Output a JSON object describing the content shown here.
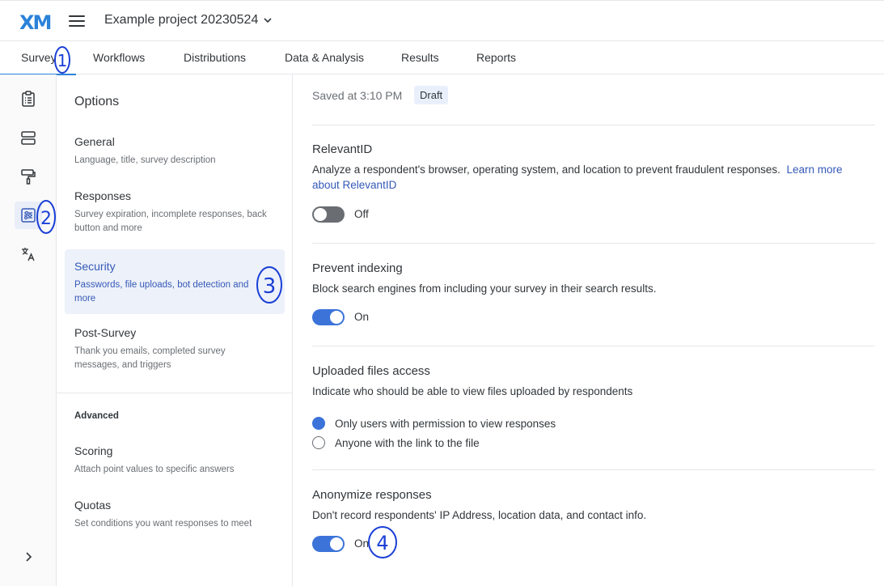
{
  "app": {
    "logo": "XM",
    "project_name": "Example project 20230524"
  },
  "tabs": [
    {
      "label": "Survey"
    },
    {
      "label": "Workflows"
    },
    {
      "label": "Distributions"
    },
    {
      "label": "Data & Analysis"
    },
    {
      "label": "Results"
    },
    {
      "label": "Reports"
    }
  ],
  "rail": {
    "icons": [
      "survey-clipboard-icon",
      "blocks-icon",
      "paint-roller-icon",
      "options-sliders-icon",
      "translate-icon"
    ],
    "expand_icon": "chevron-right-icon"
  },
  "options": {
    "title": "Options",
    "items": [
      {
        "title": "General",
        "desc": "Language, title, survey description"
      },
      {
        "title": "Responses",
        "desc": "Survey expiration, incomplete responses, back button and more"
      },
      {
        "title": "Security",
        "desc": "Passwords, file uploads, bot detection and more"
      },
      {
        "title": "Post-Survey",
        "desc": "Thank you emails, completed survey messages, and triggers"
      }
    ],
    "advanced_label": "Advanced",
    "advanced_items": [
      {
        "title": "Scoring",
        "desc": "Attach point values to specific answers"
      },
      {
        "title": "Quotas",
        "desc": "Set conditions you want responses to meet"
      }
    ]
  },
  "status": {
    "saved": "Saved at 3:10 PM",
    "badge": "Draft"
  },
  "sections": {
    "relevantid": {
      "title": "RelevantID",
      "desc": "Analyze a respondent's browser, operating system, and location to prevent fraudulent responses.",
      "link": "Learn more about RelevantID",
      "toggle": "Off"
    },
    "indexing": {
      "title": "Prevent indexing",
      "desc": "Block search engines from including your survey in their search results.",
      "toggle": "On"
    },
    "files": {
      "title": "Uploaded files access",
      "desc": "Indicate who should be able to view files uploaded by respondents",
      "options": [
        "Only users with permission to view responses",
        "Anyone with the link to the file"
      ],
      "selected": "Only users with permission to view responses"
    },
    "anonymize": {
      "title": "Anonymize responses",
      "desc": "Don't record respondents' IP Address, location data, and contact info.",
      "toggle": "On"
    }
  },
  "annotations": [
    "1",
    "2",
    "3",
    "4"
  ],
  "colors": {
    "accent": "#3b73d9",
    "active_text": "#3559b8",
    "annotation": "#1a3fd6"
  }
}
